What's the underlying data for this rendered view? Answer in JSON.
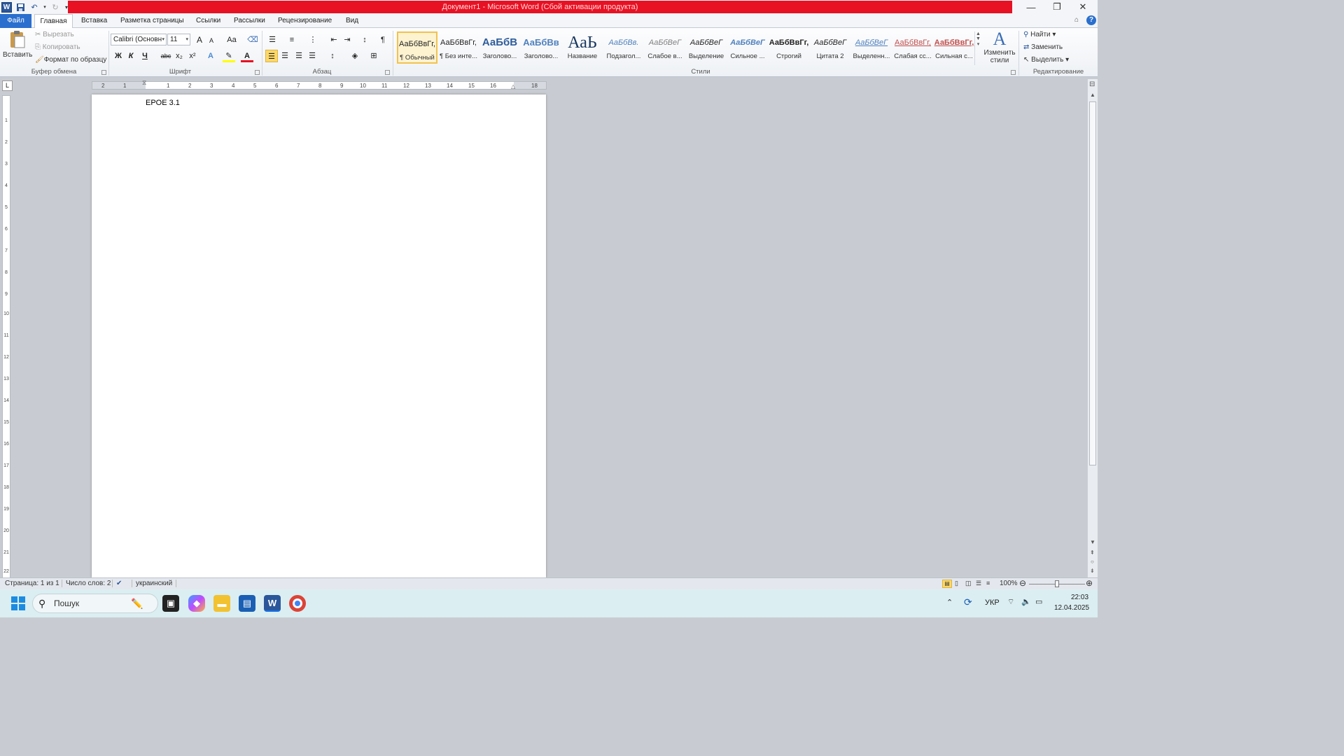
{
  "window": {
    "title": "Документ1 - Microsoft Word (Сбой активации продукта)",
    "controls": {
      "minimize": "—",
      "restore": "❐",
      "close": "✕"
    }
  },
  "tabs": {
    "file": "Файл",
    "items": [
      "Главная",
      "Вставка",
      "Разметка страницы",
      "Ссылки",
      "Рассылки",
      "Рецензирование",
      "Вид"
    ]
  },
  "ribbon": {
    "clipboard": {
      "label": "Буфер обмена",
      "paste": "Вставить",
      "cut": "Вырезать",
      "copy": "Копировать",
      "format_painter": "Формат по образцу"
    },
    "font": {
      "label": "Шрифт",
      "family": "Calibri (Основн",
      "size": "11",
      "bold": "Ж",
      "italic": "К",
      "underline": "Ч",
      "strike": "abc",
      "subscript": "x₂",
      "superscript": "x²",
      "grow": "A",
      "shrink": "A",
      "case": "Aa"
    },
    "paragraph": {
      "label": "Абзац",
      "pilcrow": "¶"
    },
    "styles": {
      "label": "Стили",
      "items": [
        {
          "sample": "АаБбВвГг,",
          "name": "¶ Обычный"
        },
        {
          "sample": "АаБбВвГг,",
          "name": "¶ Без инте..."
        },
        {
          "sample": "АаБбВ",
          "name": "Заголово..."
        },
        {
          "sample": "АаБбВв",
          "name": "Заголово..."
        },
        {
          "sample": "АаЬ",
          "name": "Название"
        },
        {
          "sample": "АаБбВв.",
          "name": "Подзагол..."
        },
        {
          "sample": "АаБбВеГ",
          "name": "Слабое в..."
        },
        {
          "sample": "АаБбВеГ",
          "name": "Выделение"
        },
        {
          "sample": "АаБбВеГ",
          "name": "Сильное ..."
        },
        {
          "sample": "АаБбВвГг,",
          "name": "Строгий"
        },
        {
          "sample": "АаБбВеГ",
          "name": "Цитата 2"
        },
        {
          "sample": "АаБбВеГ",
          "name": "Выделенн..."
        },
        {
          "sample": "АаБбВвГг,",
          "name": "Слабая сс..."
        },
        {
          "sample": "АаБбВвГг,",
          "name": "Сильная с..."
        }
      ],
      "change_styles": "Изменить стили"
    },
    "editing": {
      "label": "Редактирование",
      "find": "Найти",
      "replace": "Заменить",
      "select": "Выделить"
    }
  },
  "ruler": {
    "h_ticks": [
      "2",
      "1",
      "1",
      "2",
      "3",
      "4",
      "5",
      "6",
      "7",
      "8",
      "9",
      "10",
      "11",
      "12",
      "13",
      "14",
      "15",
      "16",
      "17",
      "18"
    ],
    "v_ticks": [
      "1",
      "2",
      "3",
      "4",
      "5",
      "6",
      "7",
      "8",
      "9",
      "10",
      "11",
      "12",
      "13",
      "14",
      "15",
      "16",
      "17",
      "18",
      "19",
      "20",
      "21",
      "22"
    ]
  },
  "document": {
    "text": "EPOE 3.1"
  },
  "status": {
    "page": "Страница: 1 из 1",
    "words": "Число слов: 2",
    "language": "украинский",
    "zoom": "100%"
  },
  "taskbar": {
    "search_placeholder": "Пошук",
    "language": "УКР",
    "time": "22:03",
    "date": "12.04.2025"
  },
  "colors": {
    "title_accent": "#e81123",
    "file_tab": "#2a6fce",
    "style_selected": "#f2c24f"
  }
}
